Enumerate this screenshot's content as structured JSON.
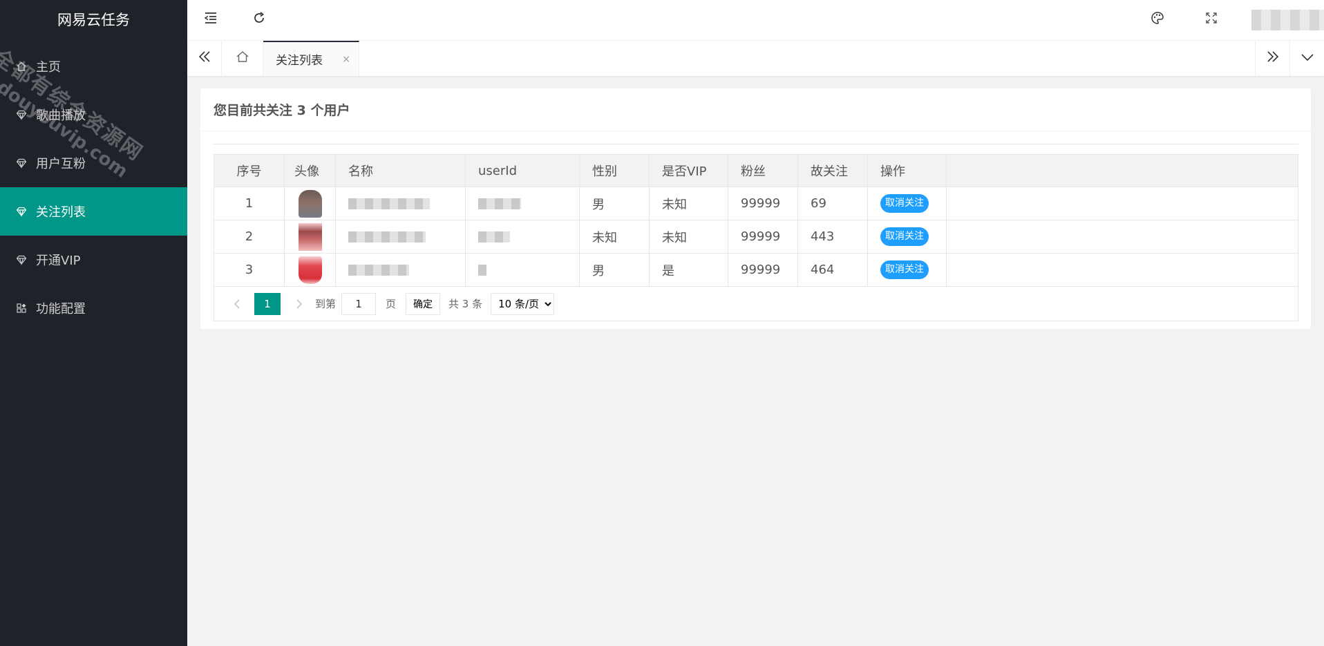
{
  "app": {
    "title": "网易云任务",
    "watermark_line1": "全都有综合资源网",
    "watermark_line2": "douyouvip.com"
  },
  "sidebar": {
    "items": [
      {
        "label": "主页",
        "icon": "home-icon",
        "active": false
      },
      {
        "label": "歌曲播放",
        "icon": "diamond-icon",
        "active": false
      },
      {
        "label": "用户互粉",
        "icon": "diamond-icon",
        "active": false
      },
      {
        "label": "关注列表",
        "icon": "diamond-icon",
        "active": true
      },
      {
        "label": "开通VIP",
        "icon": "diamond-icon",
        "active": false
      },
      {
        "label": "功能配置",
        "icon": "apps-icon",
        "active": false
      }
    ]
  },
  "header": {
    "icons": [
      "menu-collapse-icon",
      "refresh-icon",
      "theme-palette-icon",
      "fullscreen-icon"
    ]
  },
  "tabs": {
    "items": [
      {
        "label": "关注列表",
        "close": "×"
      }
    ]
  },
  "card": {
    "title": "您目前共关注 3 个用户"
  },
  "table": {
    "headers": [
      "序号",
      "头像",
      "名称",
      "userId",
      "性别",
      "是否VIP",
      "粉丝",
      "故关注",
      "操作"
    ],
    "rows": [
      {
        "idx": "1",
        "gender": "男",
        "vip": "未知",
        "fans": "99999",
        "follows": "69",
        "action": "取消关注"
      },
      {
        "idx": "2",
        "gender": "未知",
        "vip": "未知",
        "fans": "99999",
        "follows": "443",
        "action": "取消关注"
      },
      {
        "idx": "3",
        "gender": "男",
        "vip": "是",
        "fans": "99999",
        "follows": "464",
        "action": "取消关注"
      }
    ]
  },
  "pagination": {
    "current": "1",
    "goto_label": "到第",
    "goto_value": "1",
    "page_label": "页",
    "confirm": "确定",
    "total": "共 3 条",
    "page_size": "10 条/页"
  },
  "colors": {
    "sidebar_bg": "#20222a",
    "accent": "#009688",
    "button_blue": "#1e9fff"
  }
}
